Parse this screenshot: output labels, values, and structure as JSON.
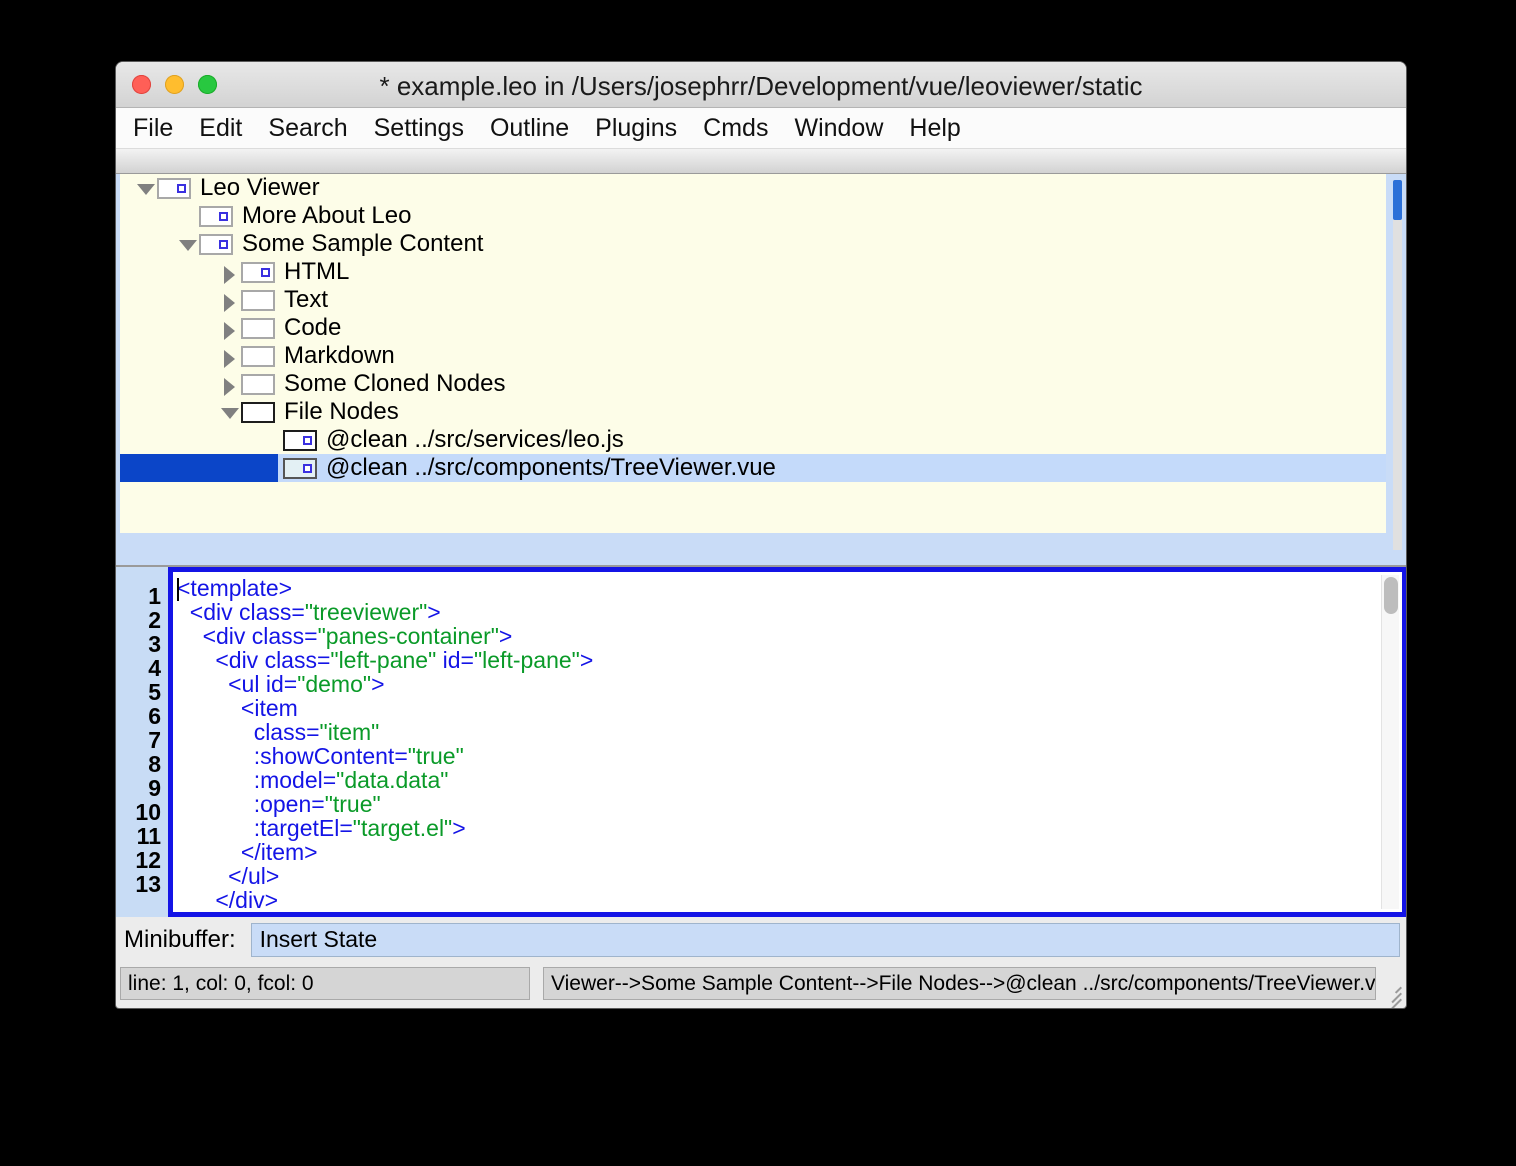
{
  "window": {
    "title": "* example.leo in /Users/josephrr/Development/vue/leoviewer/static",
    "controls": {
      "close": "close-button",
      "minimize": "minimize-button",
      "maximize": "maximize-button"
    }
  },
  "menubar": {
    "items": [
      {
        "label": "File"
      },
      {
        "label": "Edit"
      },
      {
        "label": "Search"
      },
      {
        "label": "Settings"
      },
      {
        "label": "Outline"
      },
      {
        "label": "Plugins"
      },
      {
        "label": "Cmds"
      },
      {
        "label": "Window"
      },
      {
        "label": "Help"
      }
    ]
  },
  "tree": {
    "rows": [
      {
        "label": "Leo Viewer",
        "indent": 0,
        "arrow": "down",
        "icon": "marked",
        "selected": false
      },
      {
        "label": "More About Leo",
        "indent": 1,
        "arrow": "none",
        "icon": "marked",
        "selected": false
      },
      {
        "label": "Some Sample Content",
        "indent": 1,
        "arrow": "down",
        "icon": "marked",
        "selected": false
      },
      {
        "label": "HTML",
        "indent": 2,
        "arrow": "right",
        "icon": "marked",
        "selected": false
      },
      {
        "label": "Text",
        "indent": 2,
        "arrow": "right",
        "icon": "plain",
        "selected": false
      },
      {
        "label": "Code",
        "indent": 2,
        "arrow": "right",
        "icon": "plain",
        "selected": false
      },
      {
        "label": "Markdown",
        "indent": 2,
        "arrow": "right",
        "icon": "plain",
        "selected": false
      },
      {
        "label": "Some Cloned Nodes",
        "indent": 2,
        "arrow": "right",
        "icon": "plain",
        "selected": false
      },
      {
        "label": "File Nodes",
        "indent": 2,
        "arrow": "down",
        "icon": "dark",
        "selected": false
      },
      {
        "label": "@clean ../src/services/leo.js",
        "indent": 3,
        "arrow": "none",
        "icon": "dark-marked",
        "selected": false
      },
      {
        "label": "@clean ../src/components/TreeViewer.vue",
        "indent": 3,
        "arrow": "none",
        "icon": "dotted",
        "selected": true
      }
    ]
  },
  "editor": {
    "line_numbers": [
      "1",
      "2",
      "3",
      "4",
      "5",
      "6",
      "7",
      "8",
      "9",
      "10",
      "11",
      "12",
      "13"
    ],
    "lines": [
      {
        "indent": 0,
        "parts": [
          {
            "t": "<template>",
            "k": "code"
          }
        ]
      },
      {
        "indent": 1,
        "parts": [
          {
            "t": "<div class=",
            "k": "code"
          },
          {
            "t": "\"treeviewer\"",
            "k": "str"
          },
          {
            "t": ">",
            "k": "code"
          }
        ]
      },
      {
        "indent": 2,
        "parts": [
          {
            "t": "<div class=",
            "k": "code"
          },
          {
            "t": "\"panes-container\"",
            "k": "str"
          },
          {
            "t": ">",
            "k": "code"
          }
        ]
      },
      {
        "indent": 3,
        "parts": [
          {
            "t": "<div class=",
            "k": "code"
          },
          {
            "t": "\"left-pane\"",
            "k": "str"
          },
          {
            "t": " id=",
            "k": "code"
          },
          {
            "t": "\"left-pane\"",
            "k": "str"
          },
          {
            "t": ">",
            "k": "code"
          }
        ]
      },
      {
        "indent": 4,
        "parts": [
          {
            "t": "<ul id=",
            "k": "code"
          },
          {
            "t": "\"demo\"",
            "k": "str"
          },
          {
            "t": ">",
            "k": "code"
          }
        ]
      },
      {
        "indent": 5,
        "parts": [
          {
            "t": "<item",
            "k": "code"
          }
        ]
      },
      {
        "indent": 6,
        "parts": [
          {
            "t": "class=",
            "k": "code"
          },
          {
            "t": "\"item\"",
            "k": "str"
          }
        ]
      },
      {
        "indent": 6,
        "parts": [
          {
            "t": ":showContent=",
            "k": "code"
          },
          {
            "t": "\"true\"",
            "k": "str"
          }
        ]
      },
      {
        "indent": 6,
        "parts": [
          {
            "t": ":model=",
            "k": "code"
          },
          {
            "t": "\"data.data\"",
            "k": "str"
          }
        ]
      },
      {
        "indent": 6,
        "parts": [
          {
            "t": ":open=",
            "k": "code"
          },
          {
            "t": "\"true\"",
            "k": "str"
          }
        ]
      },
      {
        "indent": 6,
        "parts": [
          {
            "t": ":targetEl=",
            "k": "code"
          },
          {
            "t": "\"target.el\"",
            "k": "str"
          },
          {
            "t": ">",
            "k": "code"
          }
        ]
      },
      {
        "indent": 5,
        "parts": [
          {
            "t": "</item>",
            "k": "code"
          }
        ]
      },
      {
        "indent": 4,
        "parts": [
          {
            "t": "</ul>",
            "k": "code"
          }
        ]
      },
      {
        "indent": 3,
        "parts": [
          {
            "t": "</div>",
            "k": "code"
          }
        ]
      }
    ],
    "colors": {
      "code": "#1414e6",
      "string": "#0a9a28",
      "focus_border": "#1414e6",
      "gutter": "#c8dcf5"
    }
  },
  "minibuffer": {
    "label": "Minibuffer:",
    "value": "Insert State",
    "placeholder": ""
  },
  "statusbar": {
    "position": "line: 1, col: 0, fcol: 0",
    "path": "Viewer-->Some Sample Content-->File Nodes-->@clean ../src/components/TreeViewer.vue"
  }
}
